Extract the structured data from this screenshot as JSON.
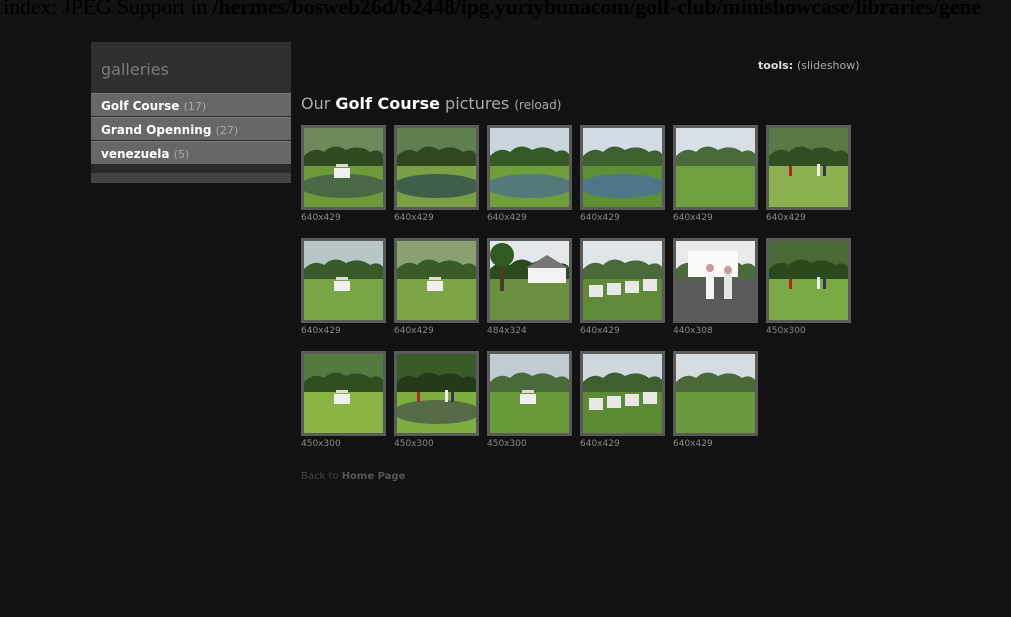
{
  "warning": {
    "prefix": "l index: JPEG Support in ",
    "path": "/hermes/bosweb26d/b2448/ipg.yuriybunacom/golf-club/minishowcase/libraries/gene"
  },
  "sidebar": {
    "title": "galleries",
    "items": [
      {
        "label": "Golf Course",
        "count": "(17)"
      },
      {
        "label": "Grand Openning",
        "count": "(27)"
      },
      {
        "label": "venezuela",
        "count": "(5)"
      }
    ]
  },
  "tools": {
    "label": "tools:",
    "slideshow": "(slideshow)"
  },
  "heading": {
    "prefix": "Our",
    "gallery": "Golf Course",
    "suffix": "pictures",
    "reload": "(reload)"
  },
  "thumbnails": [
    {
      "size": "640x429",
      "scene": "cart-pond"
    },
    {
      "size": "640x429",
      "scene": "pond"
    },
    {
      "size": "640x429",
      "scene": "pond-green"
    },
    {
      "size": "640x429",
      "scene": "lake"
    },
    {
      "size": "640x429",
      "scene": "fairway"
    },
    {
      "size": "640x429",
      "scene": "people-green"
    },
    {
      "size": "640x429",
      "scene": "carts-field"
    },
    {
      "size": "640x429",
      "scene": "carts-people"
    },
    {
      "size": "484x324",
      "scene": "clubhouse-tree"
    },
    {
      "size": "640x429",
      "scene": "cart-row"
    },
    {
      "size": "440x308",
      "scene": "two-men"
    },
    {
      "size": "450x300",
      "scene": "people-cart"
    },
    {
      "size": "450x300",
      "scene": "cart-trees"
    },
    {
      "size": "450x300",
      "scene": "golfers-green"
    },
    {
      "size": "450x300",
      "scene": "cart-closeup"
    },
    {
      "size": "640x429",
      "scene": "carts-group"
    },
    {
      "size": "640x429",
      "scene": "open-fairway"
    }
  ],
  "back": {
    "prefix": "Back to",
    "link": "Home Page"
  }
}
